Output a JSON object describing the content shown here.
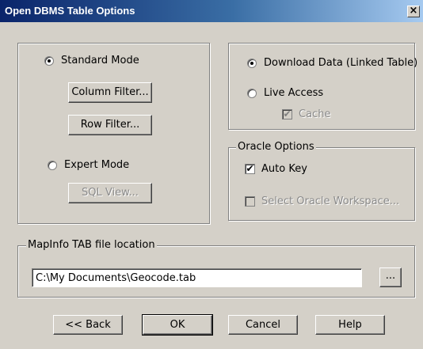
{
  "window": {
    "title": "Open DBMS Table Options",
    "close_label": "×"
  },
  "mode": {
    "standard_label": "Standard Mode",
    "column_filter_label": "Column Filter...",
    "row_filter_label": "Row Filter...",
    "expert_label": "Expert Mode",
    "sql_view_label": "SQL View...",
    "selected": "Standard Mode"
  },
  "access": {
    "download_label": "Download Data (Linked Table)",
    "live_label": "Live Access",
    "cache_label": "Cache",
    "selected": "Download Data (Linked Table)",
    "cache_checked": true
  },
  "oracle": {
    "group_label": "Oracle Options",
    "auto_key_label": "Auto Key",
    "auto_key_checked": true,
    "workspace_label": "Select Oracle Workspace...",
    "workspace_checked": false
  },
  "tab_location": {
    "group_label": "MapInfo TAB file location",
    "path_value": "C:\\My Documents\\Geocode.tab",
    "browse_label": "..."
  },
  "footer": {
    "back_label": "<< Back",
    "ok_label": "OK",
    "cancel_label": "Cancel",
    "help_label": "Help"
  },
  "icons": {
    "checkmark": "✔",
    "close": "close-icon",
    "radio_selected": "radio-dot"
  }
}
